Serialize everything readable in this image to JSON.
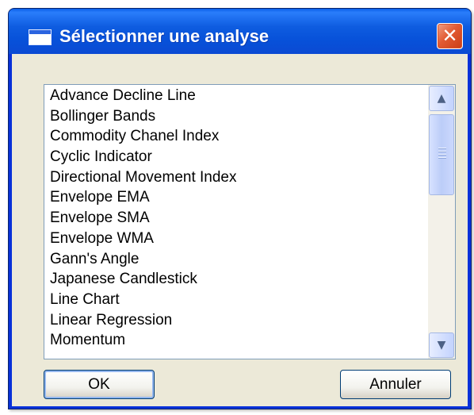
{
  "window": {
    "title": "Sélectionner une analyse",
    "close_glyph": "✕",
    "accent": "#0751d9"
  },
  "list": {
    "items": [
      "Advance Decline Line",
      "Bollinger Bands",
      "Commodity Chanel Index",
      "Cyclic Indicator",
      "Directional Movement Index",
      "Envelope EMA",
      "Envelope SMA",
      "Envelope WMA",
      "Gann's Angle",
      "Japanese Candlestick",
      "Line Chart",
      "Linear Regression",
      "Momentum"
    ],
    "scroll_up_glyph": "▲",
    "scroll_down_glyph": "▼"
  },
  "buttons": {
    "ok_label": "OK",
    "cancel_label": "Annuler"
  }
}
